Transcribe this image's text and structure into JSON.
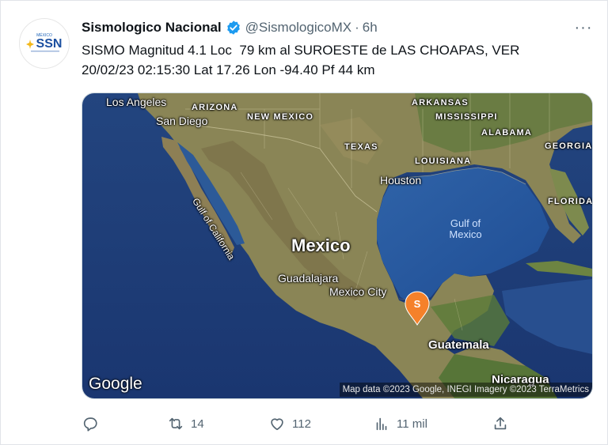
{
  "tweet": {
    "author_name": "Sismologico Nacional",
    "handle": "@SismologicoMX",
    "separator": "·",
    "time": "6h",
    "more_label": "···",
    "text_lines": [
      "SISMO Magnitud 4.1 Loc  79 km al SUROESTE de LAS CHOAPAS, VER",
      "20/02/23 02:15:30 Lat 17.26 Lon -94.40 Pf 44 km"
    ]
  },
  "avatar": {
    "logo_text": "SSN",
    "logo_top_text": "MÉXICO"
  },
  "map": {
    "labels": {
      "los_angeles": "Los Angeles",
      "san_diego": "San Diego",
      "arizona": "ARIZONA",
      "new_mexico": "NEW MEXICO",
      "arkansas": "ARKANSAS",
      "mississippi": "MISSISSIPPI",
      "alabama": "ALABAMA",
      "georgia": "GEORGIA",
      "texas": "TEXAS",
      "louisiana": "LOUISIANA",
      "houston": "Houston",
      "florida": "FLORIDA",
      "gulf_of_california": "Gulf of California",
      "gulf_of_mexico_1": "Gulf of",
      "gulf_of_mexico_2": "Mexico",
      "mexico": "Mexico",
      "guadalajara": "Guadalajara",
      "mexico_city": "Mexico City",
      "guatemala": "Guatemala",
      "nicaragua": "Nicaragua"
    },
    "marker_letter": "S",
    "google_logo": "Google",
    "attribution": "Map data ©2023 Google, INEGI Imagery ©2023 TerraMetrics",
    "colors": {
      "marker": "#f5812a",
      "ocean": "#1e3f7a",
      "land": "#8c8456"
    }
  },
  "actions": {
    "reply": {
      "icon": "reply-icon",
      "count": ""
    },
    "retweet": {
      "icon": "retweet-icon",
      "count": "14"
    },
    "like": {
      "icon": "heart-icon",
      "count": "112"
    },
    "views": {
      "icon": "views-icon",
      "count": "11 mil"
    },
    "share": {
      "icon": "share-icon",
      "count": ""
    }
  },
  "colors": {
    "verified": "#1d9bf0",
    "muted": "#536471"
  }
}
